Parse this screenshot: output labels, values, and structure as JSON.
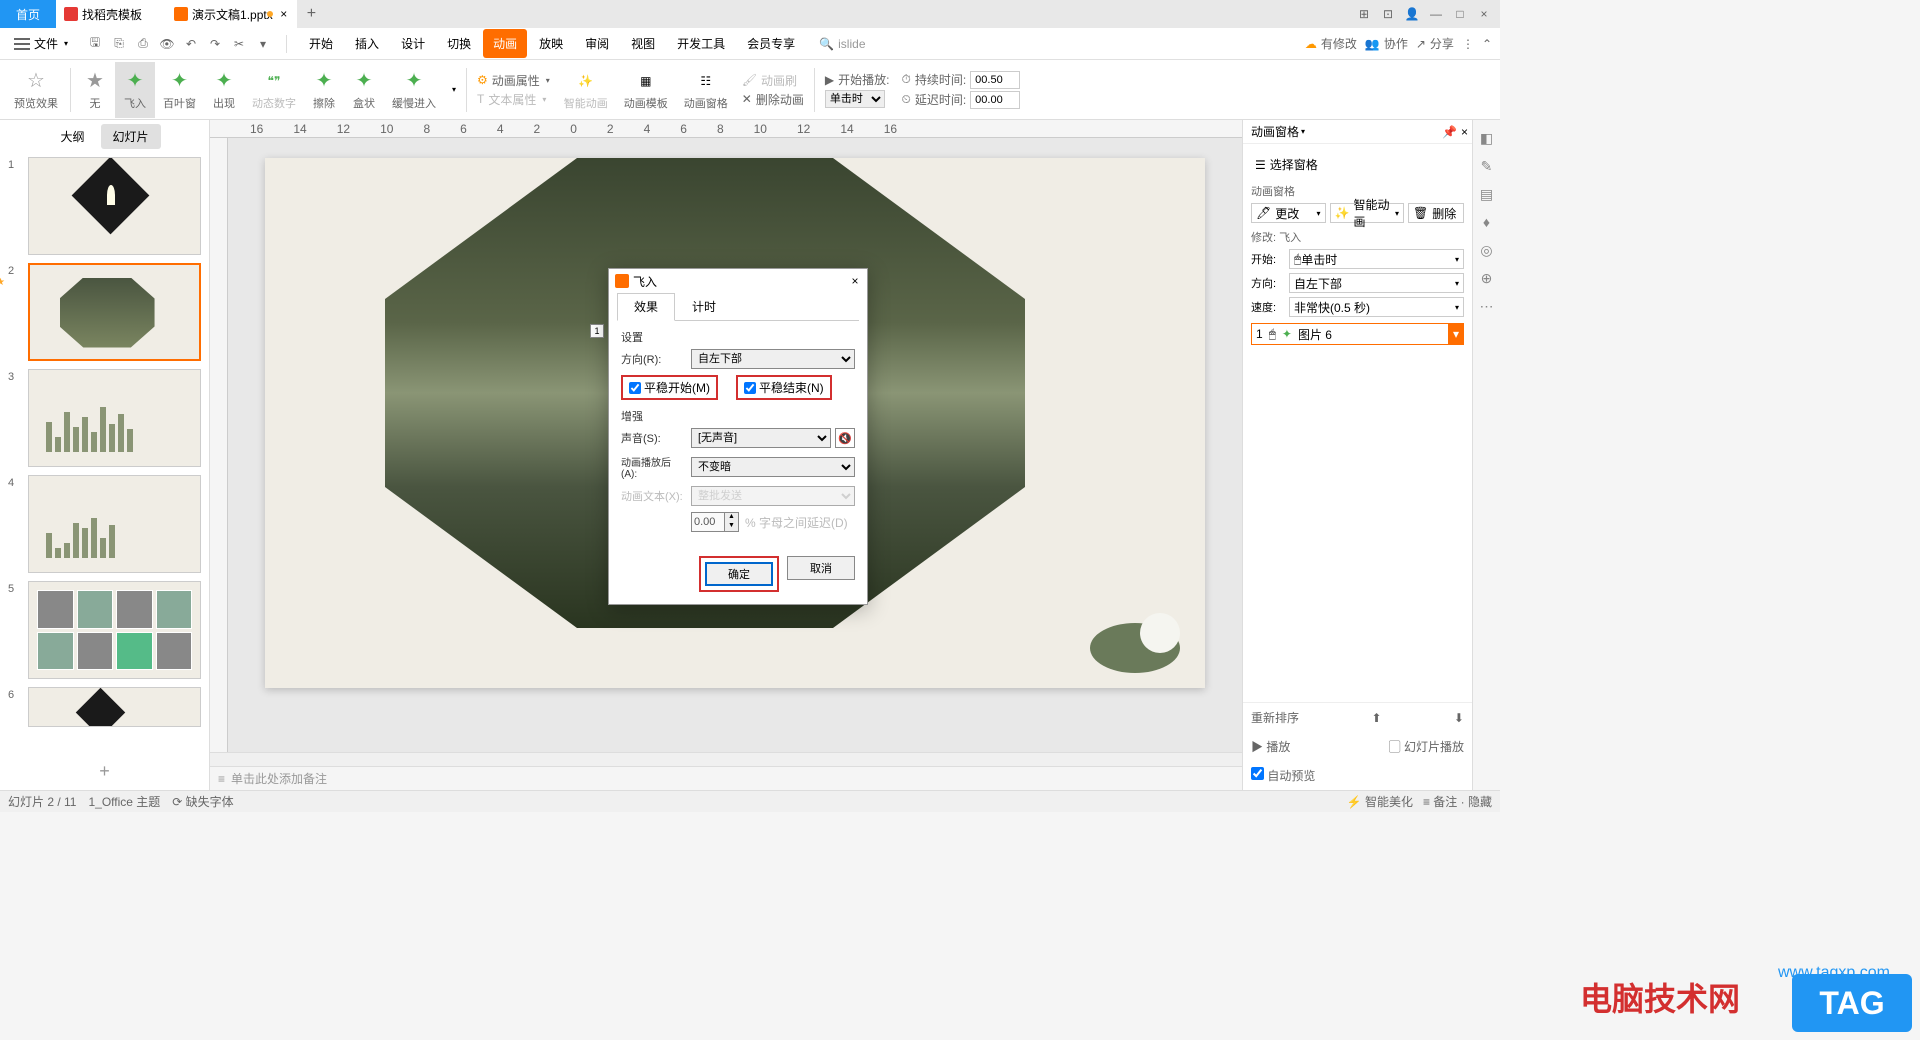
{
  "titlebar": {
    "home": "首页",
    "tab2": "找稻壳模板",
    "tab3": "演示文稿1.pptx"
  },
  "file_menu": "文件",
  "ribbon_tabs": [
    "开始",
    "插入",
    "设计",
    "切换",
    "动画",
    "放映",
    "审阅",
    "视图",
    "开发工具",
    "会员专享"
  ],
  "ribbon_active": 4,
  "search_label": "islide",
  "toolbar_right": {
    "pending": "有修改",
    "coop": "协作",
    "share": "分享"
  },
  "anim_buttons": {
    "preview": "预览效果",
    "none": "无",
    "flyin": "飞入",
    "blinds": "百叶窗",
    "appear": "出现",
    "number": "动态数字",
    "wipe": "擦除",
    "box": "盒状",
    "slowin": "缓慢进入",
    "props": "动画属性",
    "textprops": "文本属性",
    "smart": "智能动画",
    "template": "动画模板",
    "pane": "动画窗格",
    "brush": "动画刷",
    "delbrush": "删除动画"
  },
  "timing": {
    "start_label": "开始播放:",
    "duration_label": "持续时间:",
    "duration": "00.50",
    "start_select": "单击时",
    "delay_label": "延迟时间:",
    "delay": "00.00"
  },
  "thumb_tabs": {
    "outline": "大纲",
    "slides": "幻灯片"
  },
  "dialog": {
    "title": "飞入",
    "tabs": {
      "effect": "效果",
      "timing": "计时"
    },
    "settings_legend": "设置",
    "direction_label": "方向(R):",
    "direction": "自左下部",
    "smooth_start": "平稳开始(M)",
    "smooth_end": "平稳结束(N)",
    "enhance_legend": "增强",
    "sound_label": "声音(S):",
    "sound": "[无声音]",
    "after_label": "动画播放后(A):",
    "after": "不变暗",
    "text_label": "动画文本(X):",
    "text": "整批发送",
    "percent": "0.00",
    "percent_suffix": "% 字母之间延迟(D)",
    "ok": "确定",
    "cancel": "取消"
  },
  "right_panel": {
    "title": "动画窗格",
    "select_pane": "选择窗格",
    "pane_label": "动画窗格",
    "change": "更改",
    "smart": "智能动画",
    "delete": "删除",
    "modify": "修改: 飞入",
    "start_label": "开始:",
    "start": "单击时",
    "dir_label": "方向:",
    "dir": "自左下部",
    "speed_label": "速度:",
    "speed": "非常快(0.5 秒)",
    "item_num": "1",
    "item_name": "图片 6",
    "reorder": "重新排序",
    "play": "幻灯片播放",
    "autoplay": "自动预览",
    "play_btn": "播放"
  },
  "notes_placeholder": "单击此处添加备注",
  "status": {
    "slide": "幻灯片 2 / 11",
    "theme": "1_Office 主题",
    "missing": "缺失字体",
    "smart": "智能美化",
    "notes": "备注",
    "hide": "隐藏"
  },
  "watermark": {
    "cn": "电脑技术网",
    "url": "www.tagxp.com",
    "tag": "TAG"
  },
  "slide_badge": "1"
}
